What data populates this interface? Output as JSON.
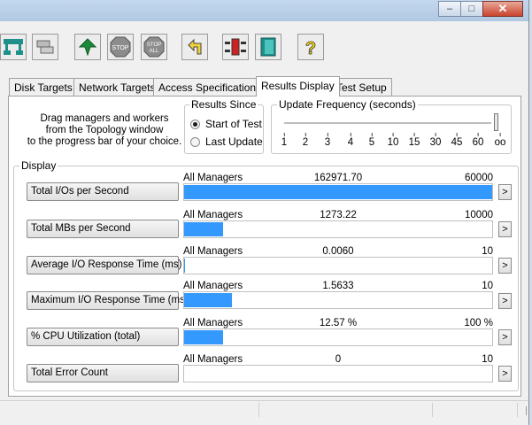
{
  "window": {
    "minimize_label": "–",
    "maximize_label": "□",
    "close_label": "✕"
  },
  "toolbar": {
    "buttons": [
      {
        "name": "topology-icon"
      },
      {
        "name": "disk-icon"
      },
      {
        "name": "start-tests-icon"
      },
      {
        "name": "stop-icon",
        "label": "STOP"
      },
      {
        "name": "stop-all-icon",
        "label": "STOP ALL"
      },
      {
        "name": "reset-workers-icon"
      },
      {
        "name": "new-manager-icon"
      },
      {
        "name": "exit-icon"
      },
      {
        "name": "help-icon",
        "label": "?"
      }
    ],
    "colors": {
      "green": "#1a8a3a",
      "teal": "#1f8f8a",
      "stop_gray": "#8c8c8c",
      "help_yellow": "#ffe100"
    }
  },
  "tabs": [
    {
      "label": "Disk Targets",
      "active": false
    },
    {
      "label": "Network Targets",
      "active": false
    },
    {
      "label": "Access Specifications",
      "active": false
    },
    {
      "label": "Results Display",
      "active": true
    },
    {
      "label": "Test Setup",
      "active": false
    }
  ],
  "help_text": {
    "line1": "Drag managers and workers",
    "line2": "from the Topology window",
    "line3": "to the progress bar of your choice."
  },
  "results_since": {
    "title": "Results Since",
    "options": [
      {
        "label": "Start of Test",
        "selected": true
      },
      {
        "label": "Last Update",
        "selected": false
      }
    ]
  },
  "update_frequency": {
    "title": "Update Frequency (seconds)",
    "ticks": [
      "1",
      "2",
      "3",
      "4",
      "5",
      "10",
      "15",
      "30",
      "45",
      "60",
      "oo"
    ],
    "selected": "oo"
  },
  "display": {
    "title": "Display",
    "metrics": [
      {
        "label": "Total I/Os per Second",
        "source": "All Managers",
        "value": "162971.70",
        "max": "60000",
        "fill_fraction": 1.0,
        "arrow": ">"
      },
      {
        "label": "Total MBs per Second",
        "source": "All Managers",
        "value": "1273.22",
        "max": "10000",
        "fill_fraction": 0.127,
        "arrow": ">"
      },
      {
        "label": "Average I/O Response Time (ms)",
        "source": "All Managers",
        "value": "0.0060",
        "max": "10",
        "fill_fraction": 0.0006,
        "arrow": ">"
      },
      {
        "label": "Maximum I/O Response Time (ms)",
        "source": "All Managers",
        "value": "1.5633",
        "max": "10",
        "fill_fraction": 0.156,
        "arrow": ">"
      },
      {
        "label": "% CPU Utilization (total)",
        "source": "All Managers",
        "value": "12.57 %",
        "max": "100 %",
        "fill_fraction": 0.1257,
        "arrow": ">"
      },
      {
        "label": "Total Error Count",
        "source": "All Managers",
        "value": "0",
        "max": "10",
        "fill_fraction": 0,
        "arrow": ">"
      }
    ],
    "bar_color": "#3399ff"
  }
}
